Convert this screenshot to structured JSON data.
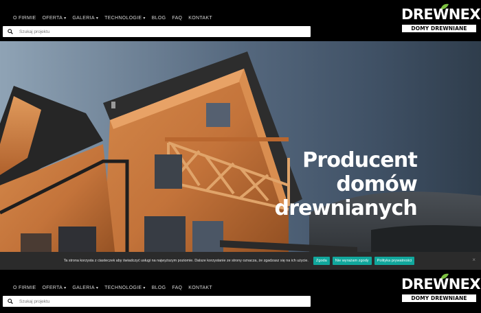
{
  "nav": {
    "items": [
      {
        "label": "O FIRMIE",
        "dropdown": false
      },
      {
        "label": "OFERTA",
        "dropdown": true
      },
      {
        "label": "GALERIA",
        "dropdown": true
      },
      {
        "label": "TECHNOLOGIE",
        "dropdown": true
      },
      {
        "label": "BLOG",
        "dropdown": false
      },
      {
        "label": "FAQ",
        "dropdown": false
      },
      {
        "label": "KONTAKT",
        "dropdown": false
      }
    ],
    "chevron_icon": "chevron-down-icon"
  },
  "search": {
    "placeholder": "Szukaj projektu",
    "value": "",
    "icon": "search-icon"
  },
  "logo": {
    "main_text": "DREWNEX",
    "sub_text": "DOMY DREWNIANE",
    "leaf_color": "#7dc242"
  },
  "hero": {
    "headline_lines": [
      "Producent",
      "domów",
      "drewnianych"
    ]
  },
  "cookie": {
    "text": "Ta strona korzysta z ciasteczek aby świadczyć usługi na najwyższym poziomie. Dalsze korzystanie ze strony oznacza, że zgadzasz się na ich użycie.",
    "accept_label": "Zgoda",
    "reject_label": "Nie wyrażam zgody",
    "policy_label": "Polityka prywatności",
    "close_label": "×",
    "button_color": "#11a79c"
  },
  "colors": {
    "header_bg": "#000000",
    "accent": "#7dc242"
  }
}
